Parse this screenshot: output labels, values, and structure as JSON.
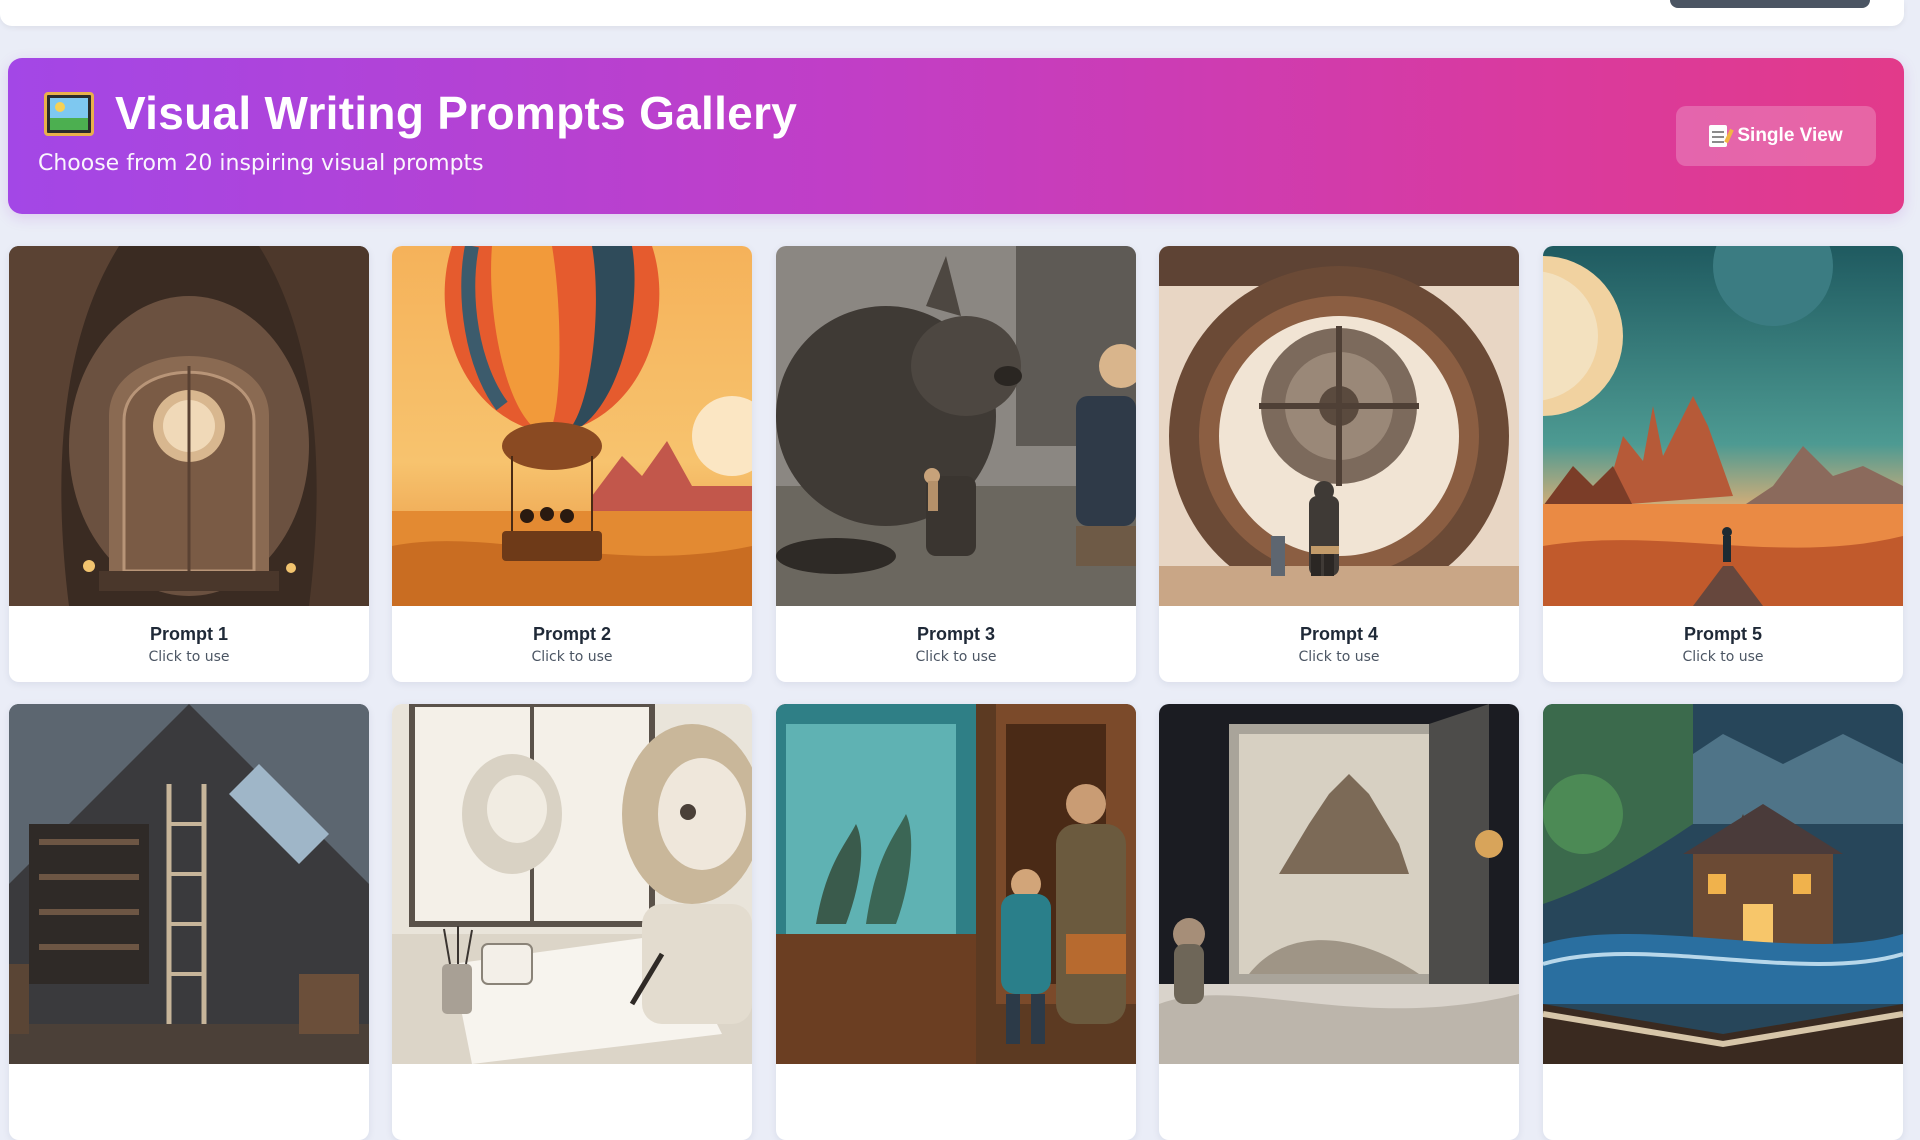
{
  "header": {
    "title": "Visual Writing Prompts Gallery",
    "subtitle": "Choose from 20 inspiring visual prompts",
    "view_button": "Single View",
    "icon": "framed-picture-icon"
  },
  "colors": {
    "gradient_start": "#a347e6",
    "gradient_end": "#e23a8a",
    "page_bg": "#eaedf7",
    "card_bg": "#ffffff"
  },
  "gallery": {
    "cards": [
      {
        "title": "Prompt 1",
        "hint": "Click to use",
        "image": "fairy tree door at night"
      },
      {
        "title": "Prompt 2",
        "hint": "Click to use",
        "image": "hot air balloon over desert sunset"
      },
      {
        "title": "Prompt 3",
        "hint": "Click to use",
        "image": "giant furry creature meets boy"
      },
      {
        "title": "Prompt 4",
        "hint": "Click to use",
        "image": "giant clockwork portal"
      },
      {
        "title": "Prompt 5",
        "hint": "Click to use",
        "image": "alien planet landscape"
      },
      {
        "image": "dusty attic with ladder"
      },
      {
        "image": "girl drawing by the window"
      },
      {
        "image": "museum bird display with grandfather"
      },
      {
        "image": "door opening to floating city"
      },
      {
        "image": "castle rising from an open book"
      }
    ]
  }
}
